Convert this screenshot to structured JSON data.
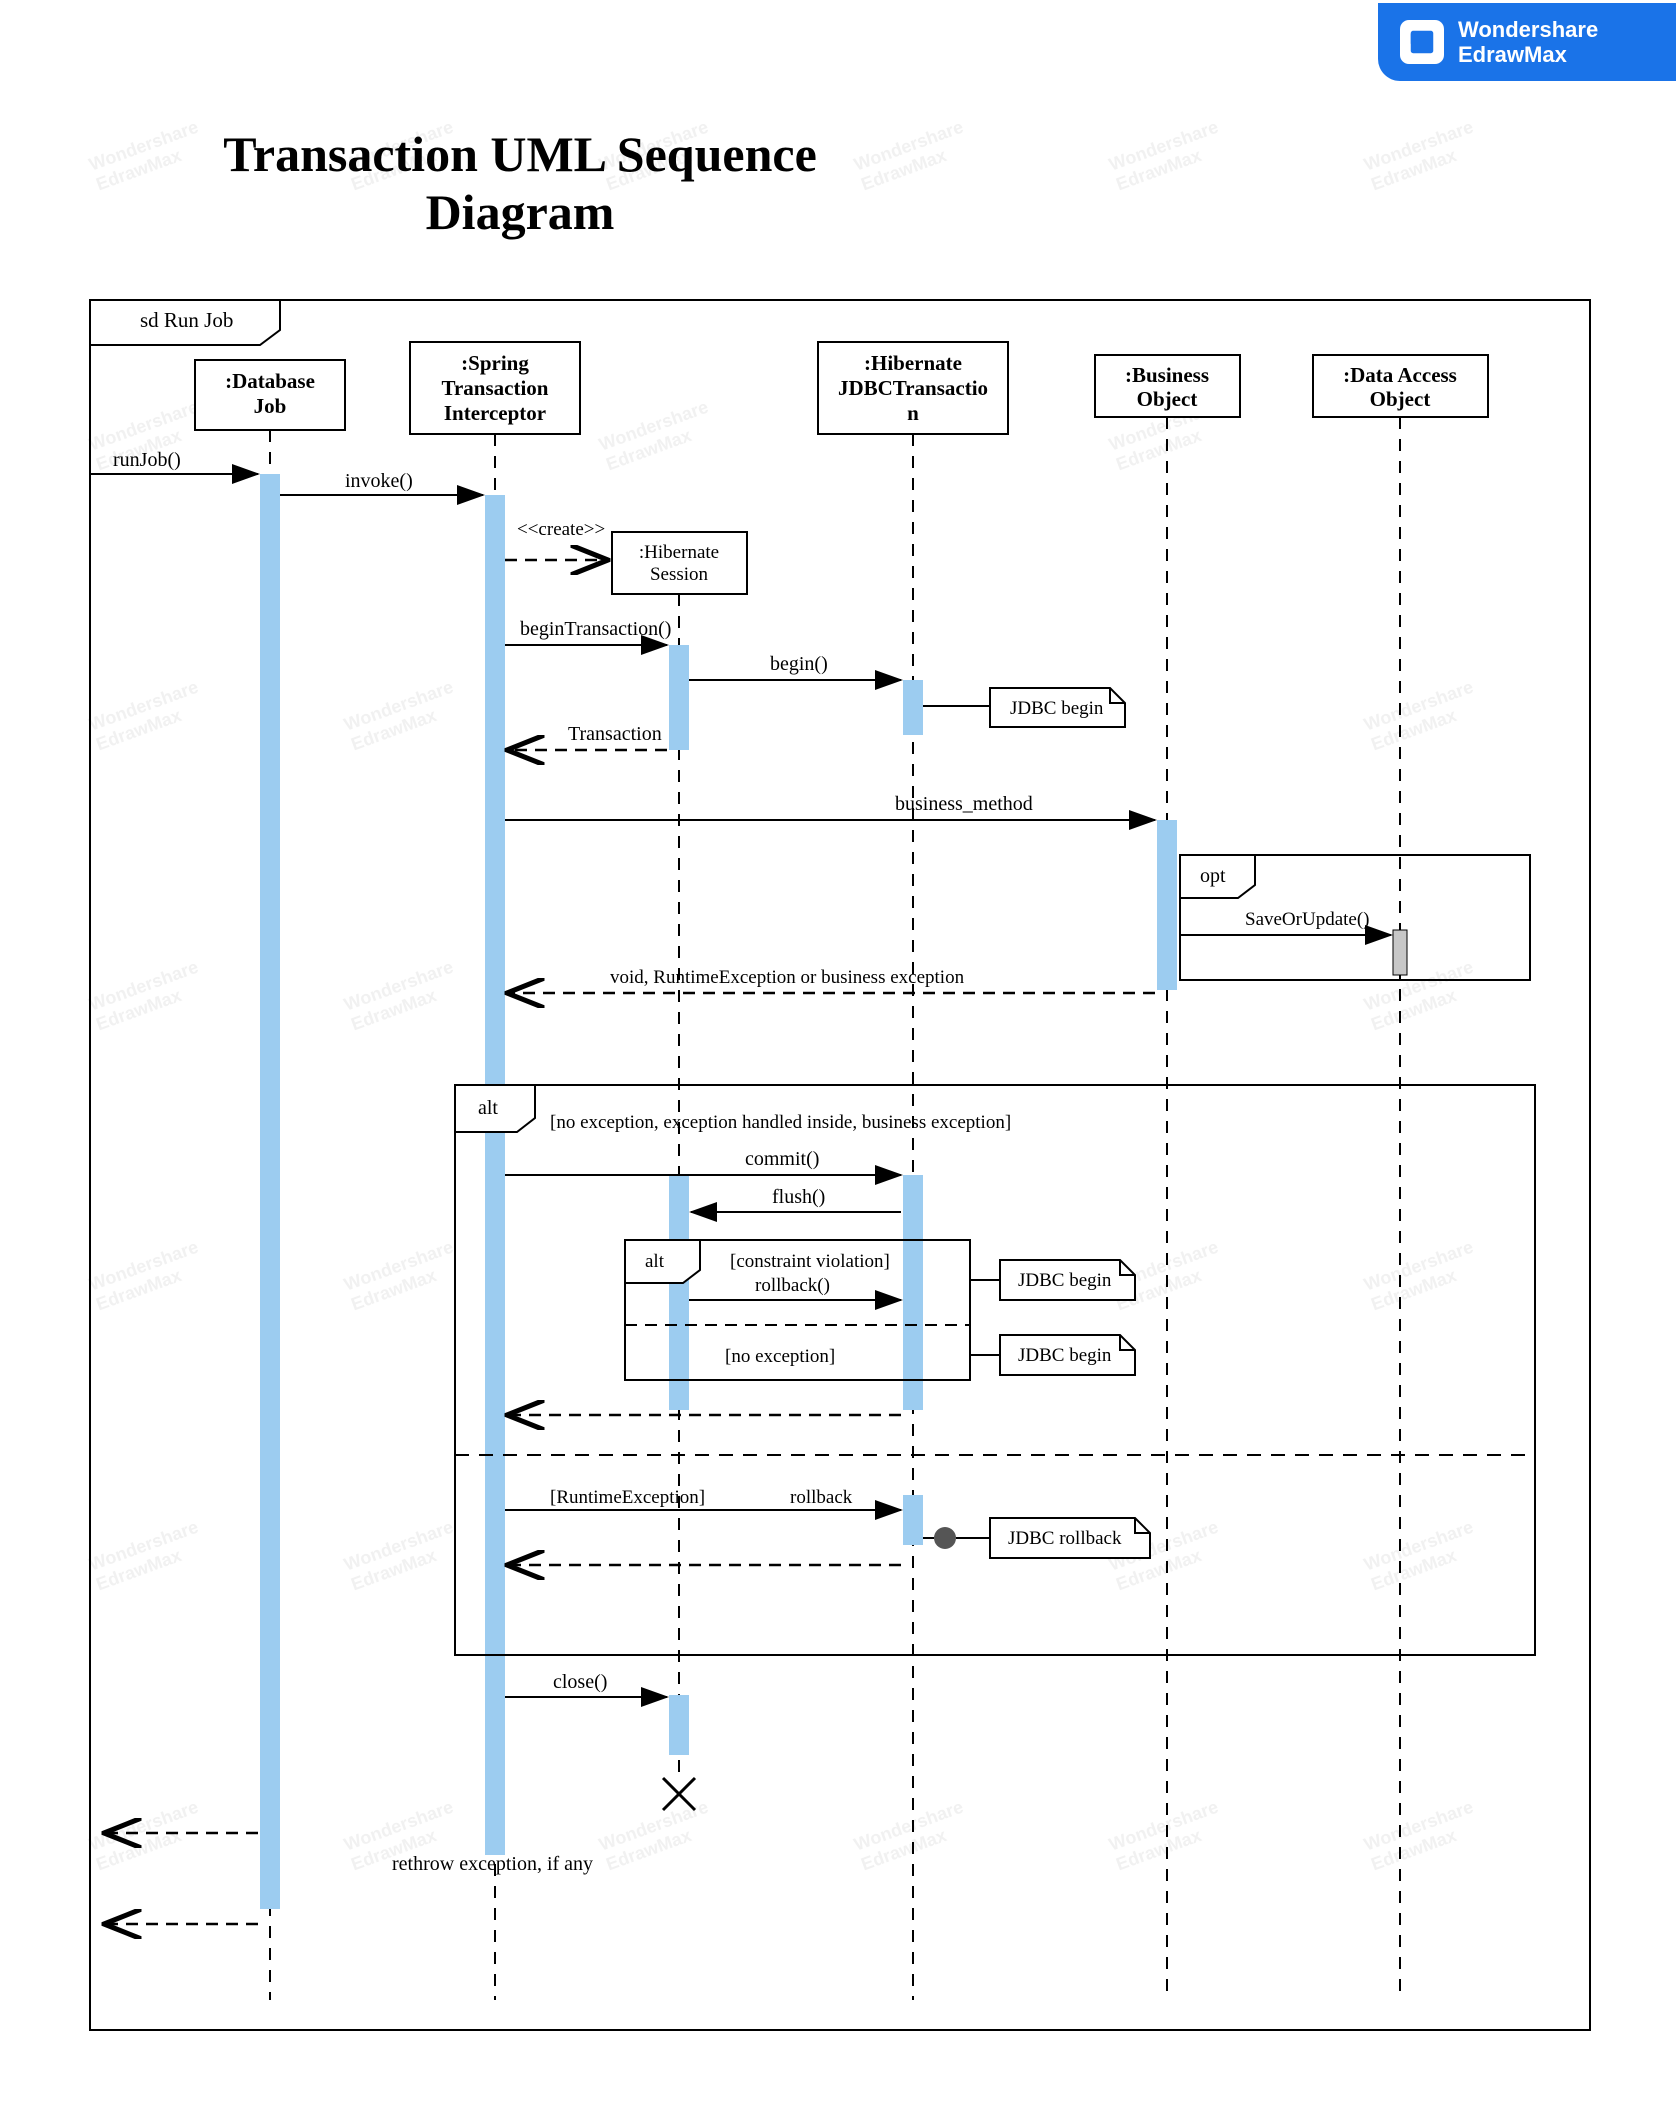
{
  "brand": {
    "line1": "Wondershare",
    "line2": "EdrawMax"
  },
  "title": "Transaction UML Sequence Diagram",
  "frame_label": "sd Run Job",
  "participants": {
    "database_job": ":Database Job",
    "spring_ti": ":Spring Transaction Interceptor",
    "hibernate_session": ":Hibernate Session",
    "hibernate_jdbc": ":Hibernate JDBCTransaction",
    "business_object": ":Business Object",
    "dao": ":Data Access Object"
  },
  "messages": {
    "runJob": "runJob()",
    "invoke": "invoke()",
    "create": "<<create>>",
    "beginTransaction": "beginTransaction()",
    "begin": "begin()",
    "transaction_return": "Transaction",
    "business_method": "business_method",
    "saveOrUpdate": "SaveOrUpdate()",
    "void_return": "void, RuntimeException or business exception",
    "commit": "commit()",
    "flush": "flush()",
    "rollback": "rollback()",
    "rollback2": "rollback",
    "close": "close()",
    "rethrow": "rethrow exception, if any"
  },
  "notes": {
    "jdbc_begin": "JDBC begin",
    "jdbc_rollback": "JDBC rollback"
  },
  "fragments": {
    "opt": "opt",
    "alt": "alt",
    "alt_guard1": "[no exception, exception handled inside, business exception]",
    "alt_guard2": "[RuntimeException]",
    "inner_guard1": "[constraint violation]",
    "inner_guard2": "[no exception]"
  }
}
